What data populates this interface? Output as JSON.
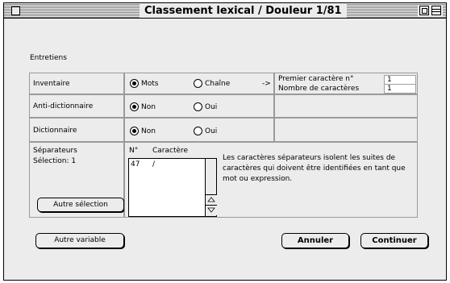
{
  "window": {
    "title": "Classement lexical / Douleur 1/81"
  },
  "section": {
    "label": "Entretiens"
  },
  "rows": [
    {
      "label": "Inventaire",
      "option_a": "Mots",
      "option_b": "Chaîne",
      "arrow": "->"
    },
    {
      "label": "Anti-dictionnaire",
      "option_a": "Non",
      "option_b": "Oui"
    },
    {
      "label": "Dictionnaire",
      "option_a": "Non",
      "option_b": "Oui"
    }
  ],
  "fields": {
    "premier_label": "Premier caractère n°",
    "premier_value": "1",
    "nombre_label": "Nombre de caractères",
    "nombre_value": "1"
  },
  "separateurs": {
    "label": "Séparateurs",
    "selection": "Sélection: 1",
    "col_no": "N°",
    "col_char": "Caractère",
    "rows": [
      {
        "no": "47",
        "char": "/"
      }
    ],
    "description": "Les caractères séparateurs isolent les suites de caractères qui doivent être identifiées en tant que mot ou expression.",
    "autre_selection": "Autre sélection"
  },
  "buttons": {
    "autre_variable": "Autre variable",
    "annuler": "Annuler",
    "continuer": "Continuer"
  }
}
